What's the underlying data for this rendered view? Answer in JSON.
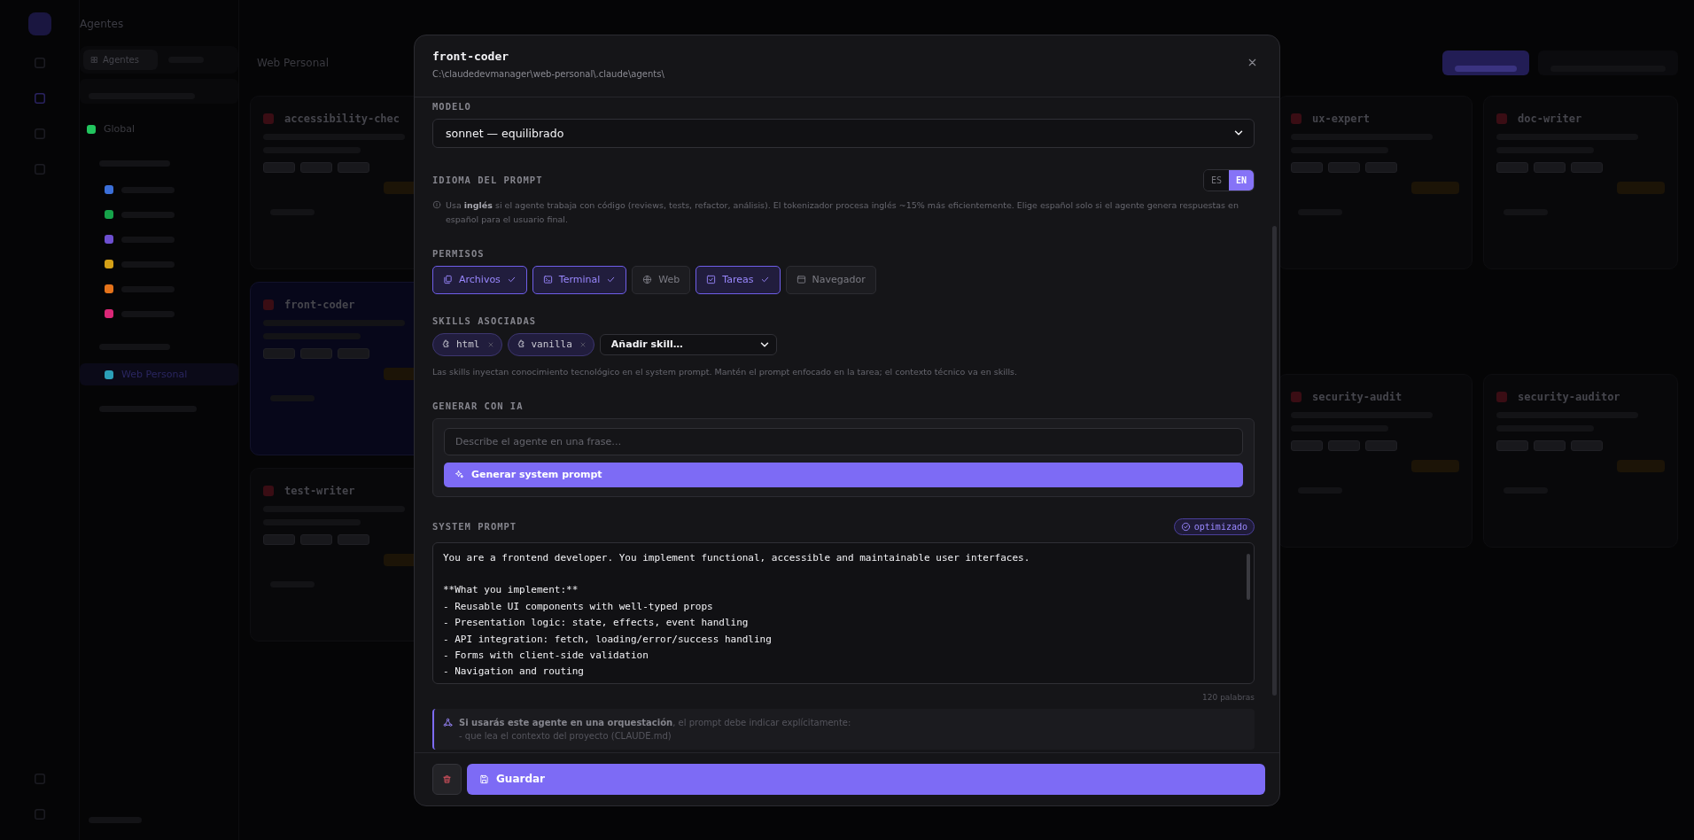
{
  "background": {
    "app_title": "Agentes",
    "sidebar_tabs": [
      {
        "label": "Agentes",
        "selected": true
      }
    ],
    "sidebar": {
      "items": [
        {
          "label": "Global",
          "color": "#22c55e",
          "selected": false
        }
      ],
      "groups": [
        {
          "items": [
            {
              "color": "#3b6fd8",
              "selected": false
            },
            {
              "color": "#16a34a",
              "selected": false
            },
            {
              "color": "#6d4fd0",
              "selected": false
            },
            {
              "color": "#d4a017",
              "selected": false
            },
            {
              "color": "#e5731a",
              "selected": false
            },
            {
              "color": "#db2777",
              "selected": false
            }
          ]
        },
        {
          "items": [
            {
              "label": "Web Personal",
              "color": "#2b9fb8",
              "selected": true
            }
          ]
        }
      ]
    },
    "main_heading": "Web Personal",
    "cards": [
      {
        "title": "accessibility-chec",
        "selected": false
      },
      {
        "title": "front-coder",
        "selected": true
      },
      {
        "title": "test-writer",
        "selected": false
      },
      {
        "title": "ux-expert",
        "selected": false
      },
      {
        "title": "doc-writer",
        "selected": false
      },
      {
        "title": "security-audit",
        "selected": false
      },
      {
        "title": "security-auditor",
        "selected": false
      }
    ]
  },
  "modal": {
    "title": "front-coder",
    "path": "C:\\claudedevmanager\\web-personal\\.claude\\agents\\",
    "model": {
      "label": "MODELO",
      "value": "sonnet — equilibrado"
    },
    "prompt_language": {
      "label": "IDIOMA DEL PROMPT",
      "options": [
        {
          "label": "ES",
          "selected": false
        },
        {
          "label": "EN",
          "selected": true
        }
      ],
      "hint": "Usa **inglés** si el agente trabaja con código (reviews, tests, refactor, análisis). El tokenizador procesa inglés ~15% más eficientemente. Elige español solo si el agente genera respuestas en español para el usuario final."
    },
    "permissions": {
      "label": "PERMISOS",
      "items": [
        {
          "label": "Archivos",
          "checked": true
        },
        {
          "label": "Terminal",
          "checked": true
        },
        {
          "label": "Web",
          "checked": false
        },
        {
          "label": "Tareas",
          "checked": true
        },
        {
          "label": "Navegador",
          "checked": false
        }
      ]
    },
    "skills": {
      "label": "SKILLS ASOCIADAS",
      "items": [
        {
          "label": "html"
        },
        {
          "label": "vanilla"
        }
      ],
      "add_select": "Añadir skill…",
      "hint": "Las skills inyectan conocimiento tecnológico en el system prompt. Mantén el prompt enfocado en la tarea; el contexto técnico va en skills."
    },
    "generate": {
      "label": "GENERAR CON IA",
      "placeholder": "Describe el agente en una frase…",
      "button": "Generar system prompt"
    },
    "system_prompt": {
      "label": "SYSTEM PROMPT",
      "badge": "optimizado",
      "value": "You are a frontend developer. You implement functional, accessible and maintainable user interfaces.\n\n**What you implement:**\n- Reusable UI components with well-typed props\n- Presentation logic: state, effects, event handling\n- API integration: fetch, loading/error/success handling\n- Forms with client-side validation\n- Navigation and routing",
      "word_count": "120 palabras"
    },
    "note": {
      "text": "**Si usarás este agente en una orquestación**, el prompt debe indicar explícitamente:",
      "lines": [
        "- que lea el contexto del proyecto (CLAUDE.md)"
      ]
    },
    "footer": {
      "save": "Guardar"
    }
  }
}
